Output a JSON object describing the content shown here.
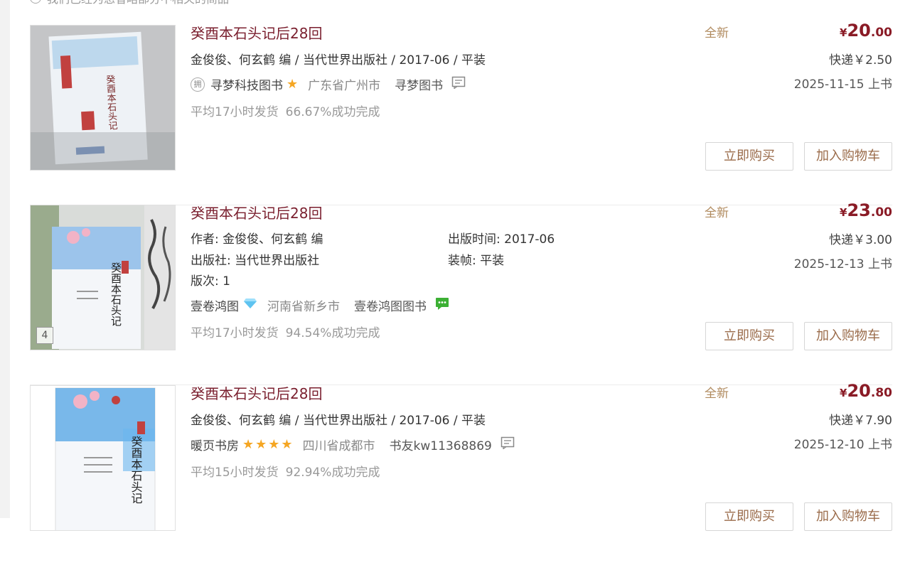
{
  "notice": {
    "text": "我们已经为您省略部分不相关的商品"
  },
  "buttons": {
    "buy_label": "立即购买",
    "cart_label": "加入购物车"
  },
  "colors": {
    "title": "#7a1f2e",
    "price": "#8a1b26",
    "condition": "#b08a5e",
    "star": "#f5a623",
    "chat_green": "#3cb034"
  },
  "listings": [
    {
      "title": "癸酉本石头记后28回",
      "meta": "金俊俊、何玄鹤 编 / 当代世界出版社 / 2017-06 / 平装",
      "badge": "拥",
      "shop": "寻梦科技图书",
      "shop_rating_icon": "star-icon",
      "stars": 1,
      "location": "广东省广州市",
      "seller": "寻梦图书",
      "chat_icon": "message-icon",
      "ship_time": "平均17小时发货",
      "success_rate": "66.67%成功完成",
      "condition": "全新",
      "price_symbol": "¥",
      "price_int": "20",
      "price_dec": ".00",
      "shipping": "快递￥2.50",
      "listed": "2025-11-15 上书"
    },
    {
      "title": "癸酉本石头记后28回",
      "details": {
        "author": "作者: 金俊俊、何玄鹤 编",
        "pub_date": "出版时间: 2017-06",
        "publisher": "出版社: 当代世界出版社",
        "binding": "装帧: 平装",
        "edition": "版次: 1"
      },
      "image_count": "4",
      "shop": "壹卷鸿图",
      "shop_rating_icon": "diamond-icon",
      "location": "河南省新乡市",
      "seller": "壹卷鸿图图书",
      "chat_icon": "chat-bubble-green-icon",
      "ship_time": "平均17小时发货",
      "success_rate": "94.54%成功完成",
      "condition": "全新",
      "price_symbol": "¥",
      "price_int": "23",
      "price_dec": ".00",
      "shipping": "快递￥3.00",
      "listed": "2025-12-13 上书"
    },
    {
      "title": "癸酉本石头记后28回",
      "meta": "金俊俊、何玄鹤 编 / 当代世界出版社 / 2017-06 / 平装",
      "shop": "暖页书房",
      "shop_rating_icon": "star-icon",
      "stars": 4,
      "location": "四川省成都市",
      "seller": "书友kw11368869",
      "chat_icon": "message-icon",
      "ship_time": "平均15小时发货",
      "success_rate": "92.94%成功完成",
      "condition": "全新",
      "price_symbol": "¥",
      "price_int": "20",
      "price_dec": ".80",
      "shipping": "快递￥7.90",
      "listed": "2025-12-10 上书"
    }
  ]
}
